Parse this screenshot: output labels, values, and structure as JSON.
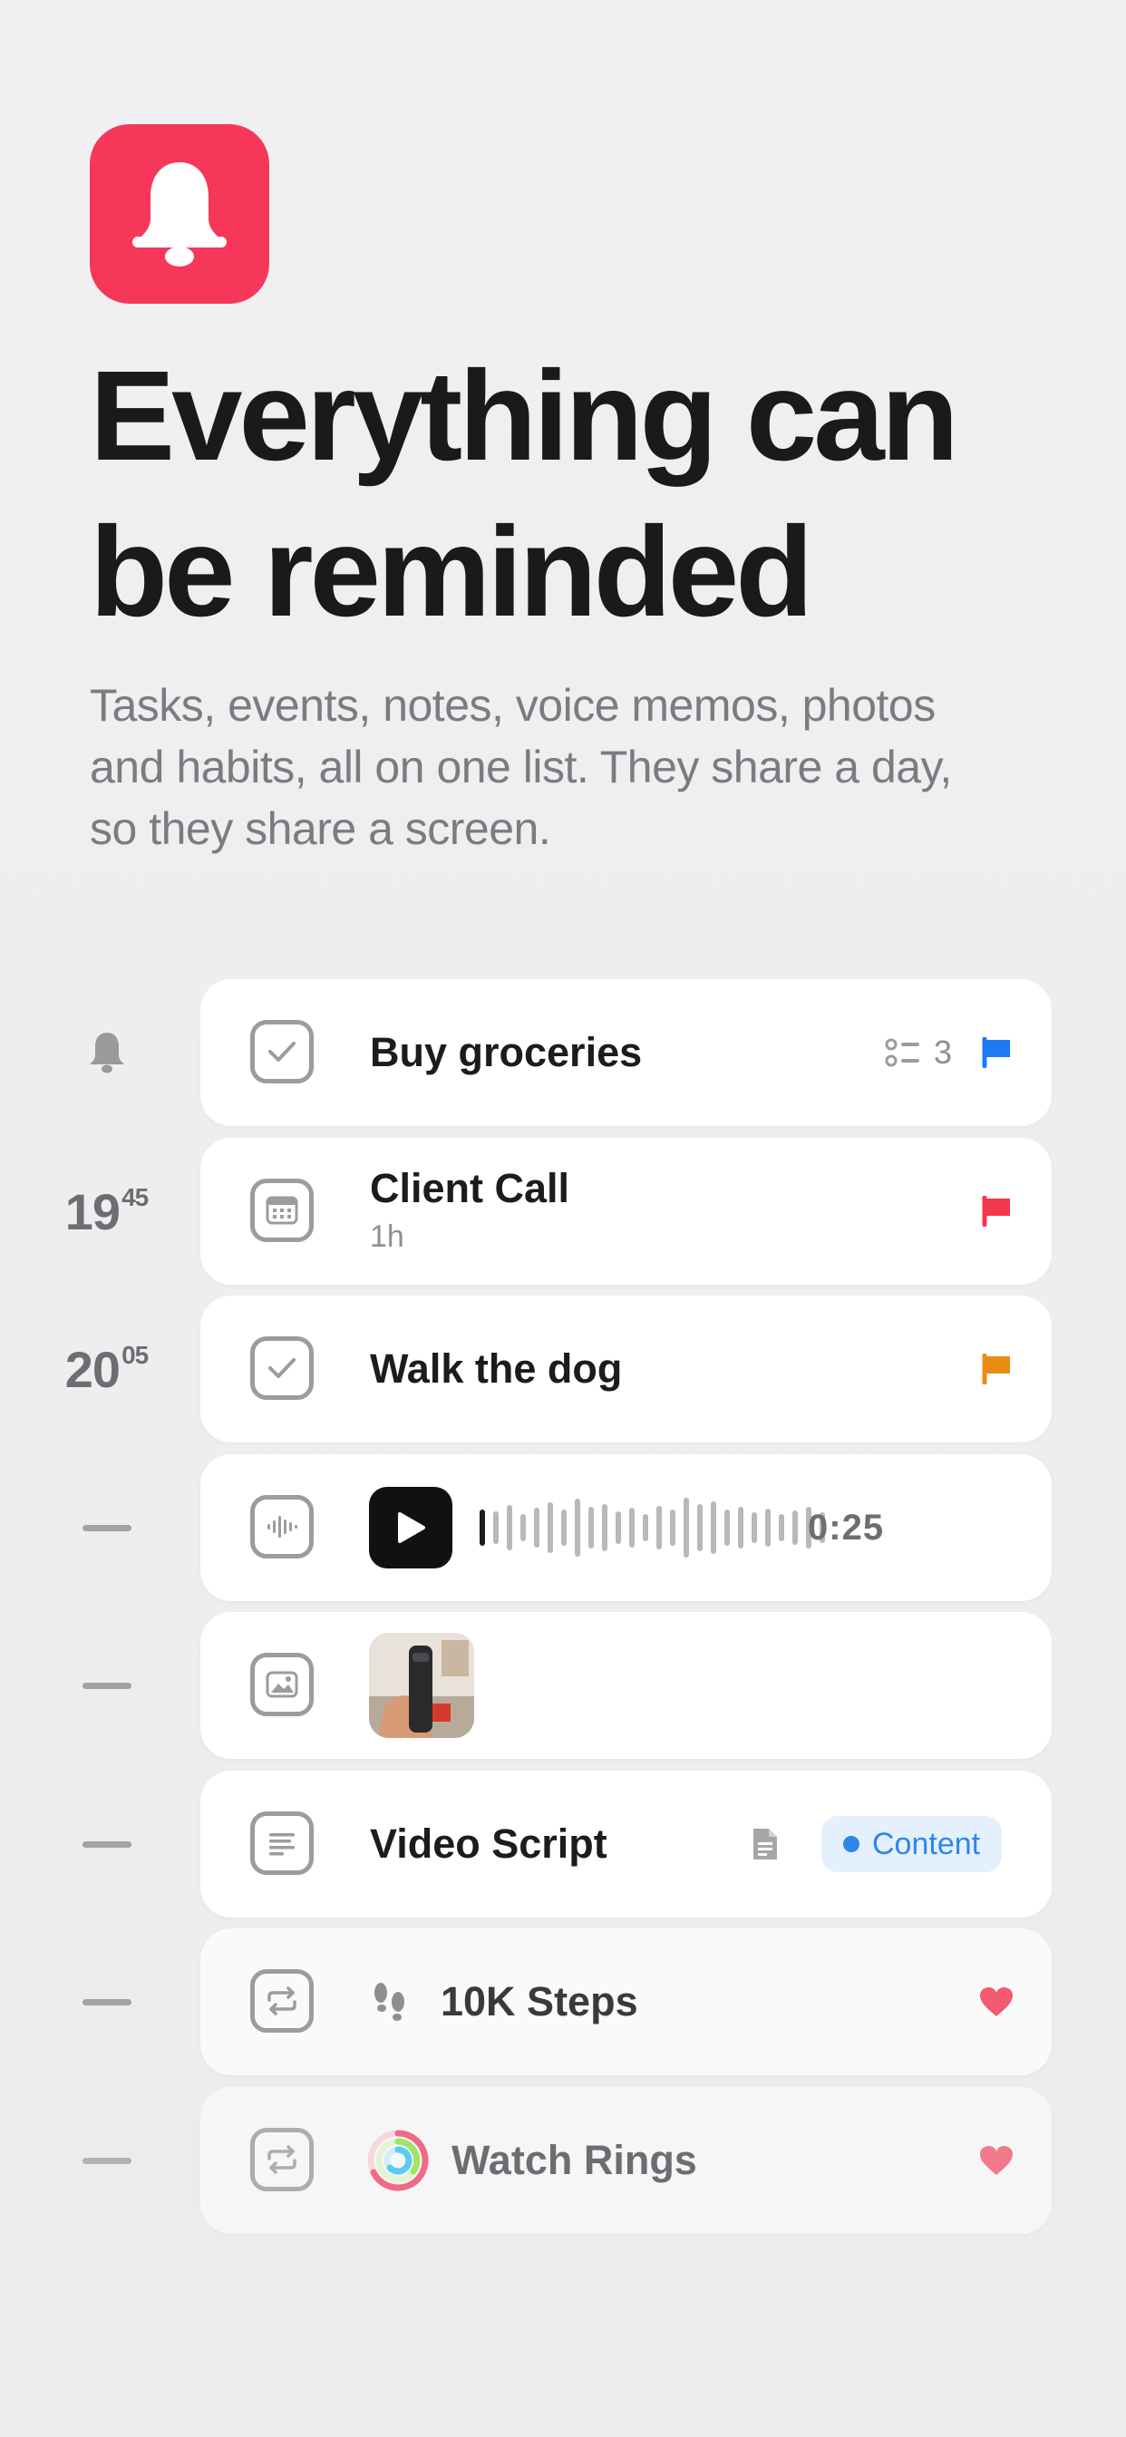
{
  "hero": {
    "headline_line1": "Everything can",
    "headline_line2": "be reminded",
    "subtitle": "Tasks, events, notes, voice memos, photos and habits, all on one list. They share a day, so they share a screen.",
    "app_icon": "bell-icon",
    "accent_color": "#f7375a"
  },
  "rows": [
    {
      "lead": "bell-icon",
      "type_icon": "checkbox-icon",
      "title": "Buy groceries",
      "subtasks_count": "3",
      "flag_color": "#1d7af0"
    },
    {
      "lead_hour": "19",
      "lead_minute": "45",
      "type_icon": "calendar-icon",
      "title": "Client Call",
      "subtitle": "1h",
      "flag_color": "#f4364f"
    },
    {
      "lead_hour": "20",
      "lead_minute": "05",
      "type_icon": "checkbox-icon",
      "title": "Walk the dog",
      "flag_color": "#ea8b12"
    },
    {
      "lead": "dash",
      "type_icon": "waveform-icon",
      "duration": "0:25",
      "progress": 0.03
    },
    {
      "lead": "dash",
      "type_icon": "photo-icon",
      "photo": "photo-thumbnail"
    },
    {
      "lead": "dash",
      "type_icon": "note-icon",
      "title": "Video Script",
      "attachment_icon": "document-icon",
      "tag": "Content",
      "tag_color": "#2f86e8"
    },
    {
      "lead": "dash",
      "type_icon": "repeat-icon",
      "habit_icon": "footsteps-icon",
      "title": "10K Steps",
      "heart_color": "#f25a6f"
    },
    {
      "lead": "dash",
      "type_icon": "repeat-icon",
      "habit_icon": "activity-rings-icon",
      "title": "Watch Rings",
      "heart_color": "#f25a6f"
    }
  ]
}
